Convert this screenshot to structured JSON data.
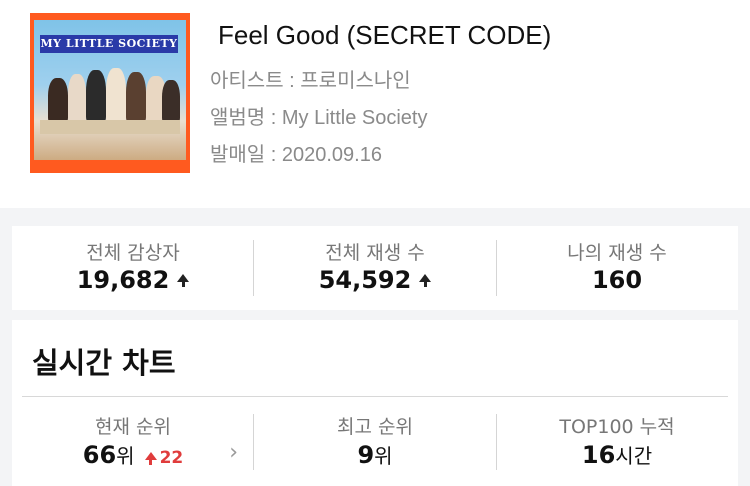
{
  "song": {
    "title": "Feel Good (SECRET CODE)",
    "artist_line": "아티스트 : 프로미스나인",
    "album_line": "앨범명 : My Little Society",
    "release_line": "발매일 : 2020.09.16",
    "cover_text": "MY LITTLE SOCIETY"
  },
  "stats": [
    {
      "label": "전체 감상자",
      "value": "19,682",
      "trend": "up"
    },
    {
      "label": "전체 재생 수",
      "value": "54,592",
      "trend": "up"
    },
    {
      "label": "나의 재생 수",
      "value": "160",
      "trend": ""
    }
  ],
  "realtime": {
    "heading": "실시간 차트",
    "current": {
      "label": "현재 순위",
      "value": "66",
      "unit": "위",
      "change": "22"
    },
    "best": {
      "label": "최고 순위",
      "value": "9",
      "unit": "위"
    },
    "top100": {
      "label": "TOP100 누적",
      "value": "16",
      "unit": "시간"
    }
  },
  "colors": {
    "accent_red": "#e03c3c",
    "cover_orange": "#ff5a1f"
  }
}
